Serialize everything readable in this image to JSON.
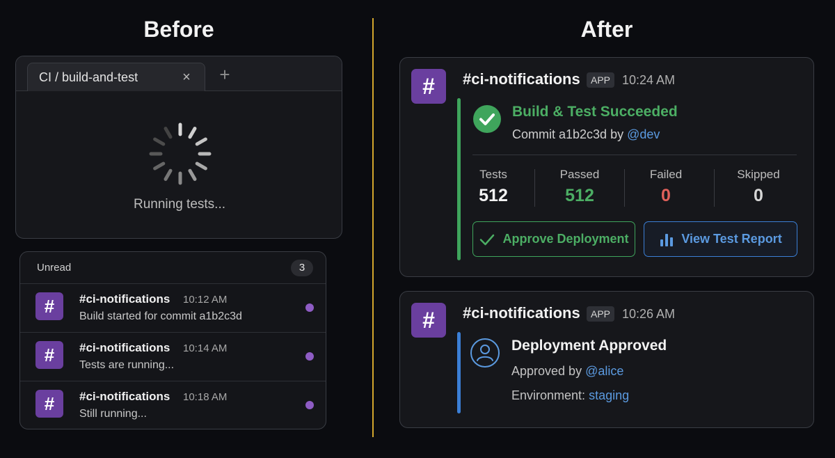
{
  "headings": {
    "before": "Before",
    "after": "After"
  },
  "tab_window": {
    "tab_title": "CI / build-and-test",
    "close_glyph": "×",
    "add_glyph": "+",
    "status_text": "Running tests..."
  },
  "unread": {
    "title": "Unread",
    "count": "3",
    "items": [
      {
        "channel": "#ci-notifications",
        "time": "10:12 AM",
        "text": "Build started for commit a1b2c3d"
      },
      {
        "channel": "#ci-notifications",
        "time": "10:14 AM",
        "text": "Tests are running..."
      },
      {
        "channel": "#ci-notifications",
        "time": "10:18 AM",
        "text": "Still running..."
      }
    ],
    "hash_glyph": "#"
  },
  "cards": [
    {
      "channel": "#ci-notifications",
      "badge": "APP",
      "time": "10:24 AM",
      "title": "Build & Test Succeeded",
      "commit_prefix": "Commit a1b2c3d by ",
      "commit_author": "@dev",
      "stats": [
        {
          "label": "Tests",
          "value": "512",
          "color": "#f2f2f2"
        },
        {
          "label": "Passed",
          "value": "512",
          "color": "#4cae64"
        },
        {
          "label": "Failed",
          "value": "0",
          "color": "#e0605a"
        },
        {
          "label": "Skipped",
          "value": "0",
          "color": "#d6d6d6"
        }
      ],
      "approve_label": "Approve Deployment",
      "report_label": "View Test Report",
      "accent_color": "#3fa55c"
    },
    {
      "channel": "#ci-notifications",
      "badge": "APP",
      "time": "10:26 AM",
      "title": "Deployment Approved",
      "approved_prefix": "Approved by ",
      "approved_user": "@alice",
      "env_prefix": "Environment: ",
      "env_value": "staging",
      "accent_color": "#3b7fd6"
    }
  ],
  "colors": {
    "accent_divider": "#d4a72c",
    "channel_icon_bg": "#6a3f9f",
    "unread_dot": "#8e5cc4",
    "link": "#5b9ae0"
  },
  "icons": {
    "spinner": "loading-spinner-icon",
    "check": "check-circle-icon",
    "checkmark": "checkmark-icon",
    "chart": "bar-chart-icon",
    "user": "user-circle-icon"
  }
}
